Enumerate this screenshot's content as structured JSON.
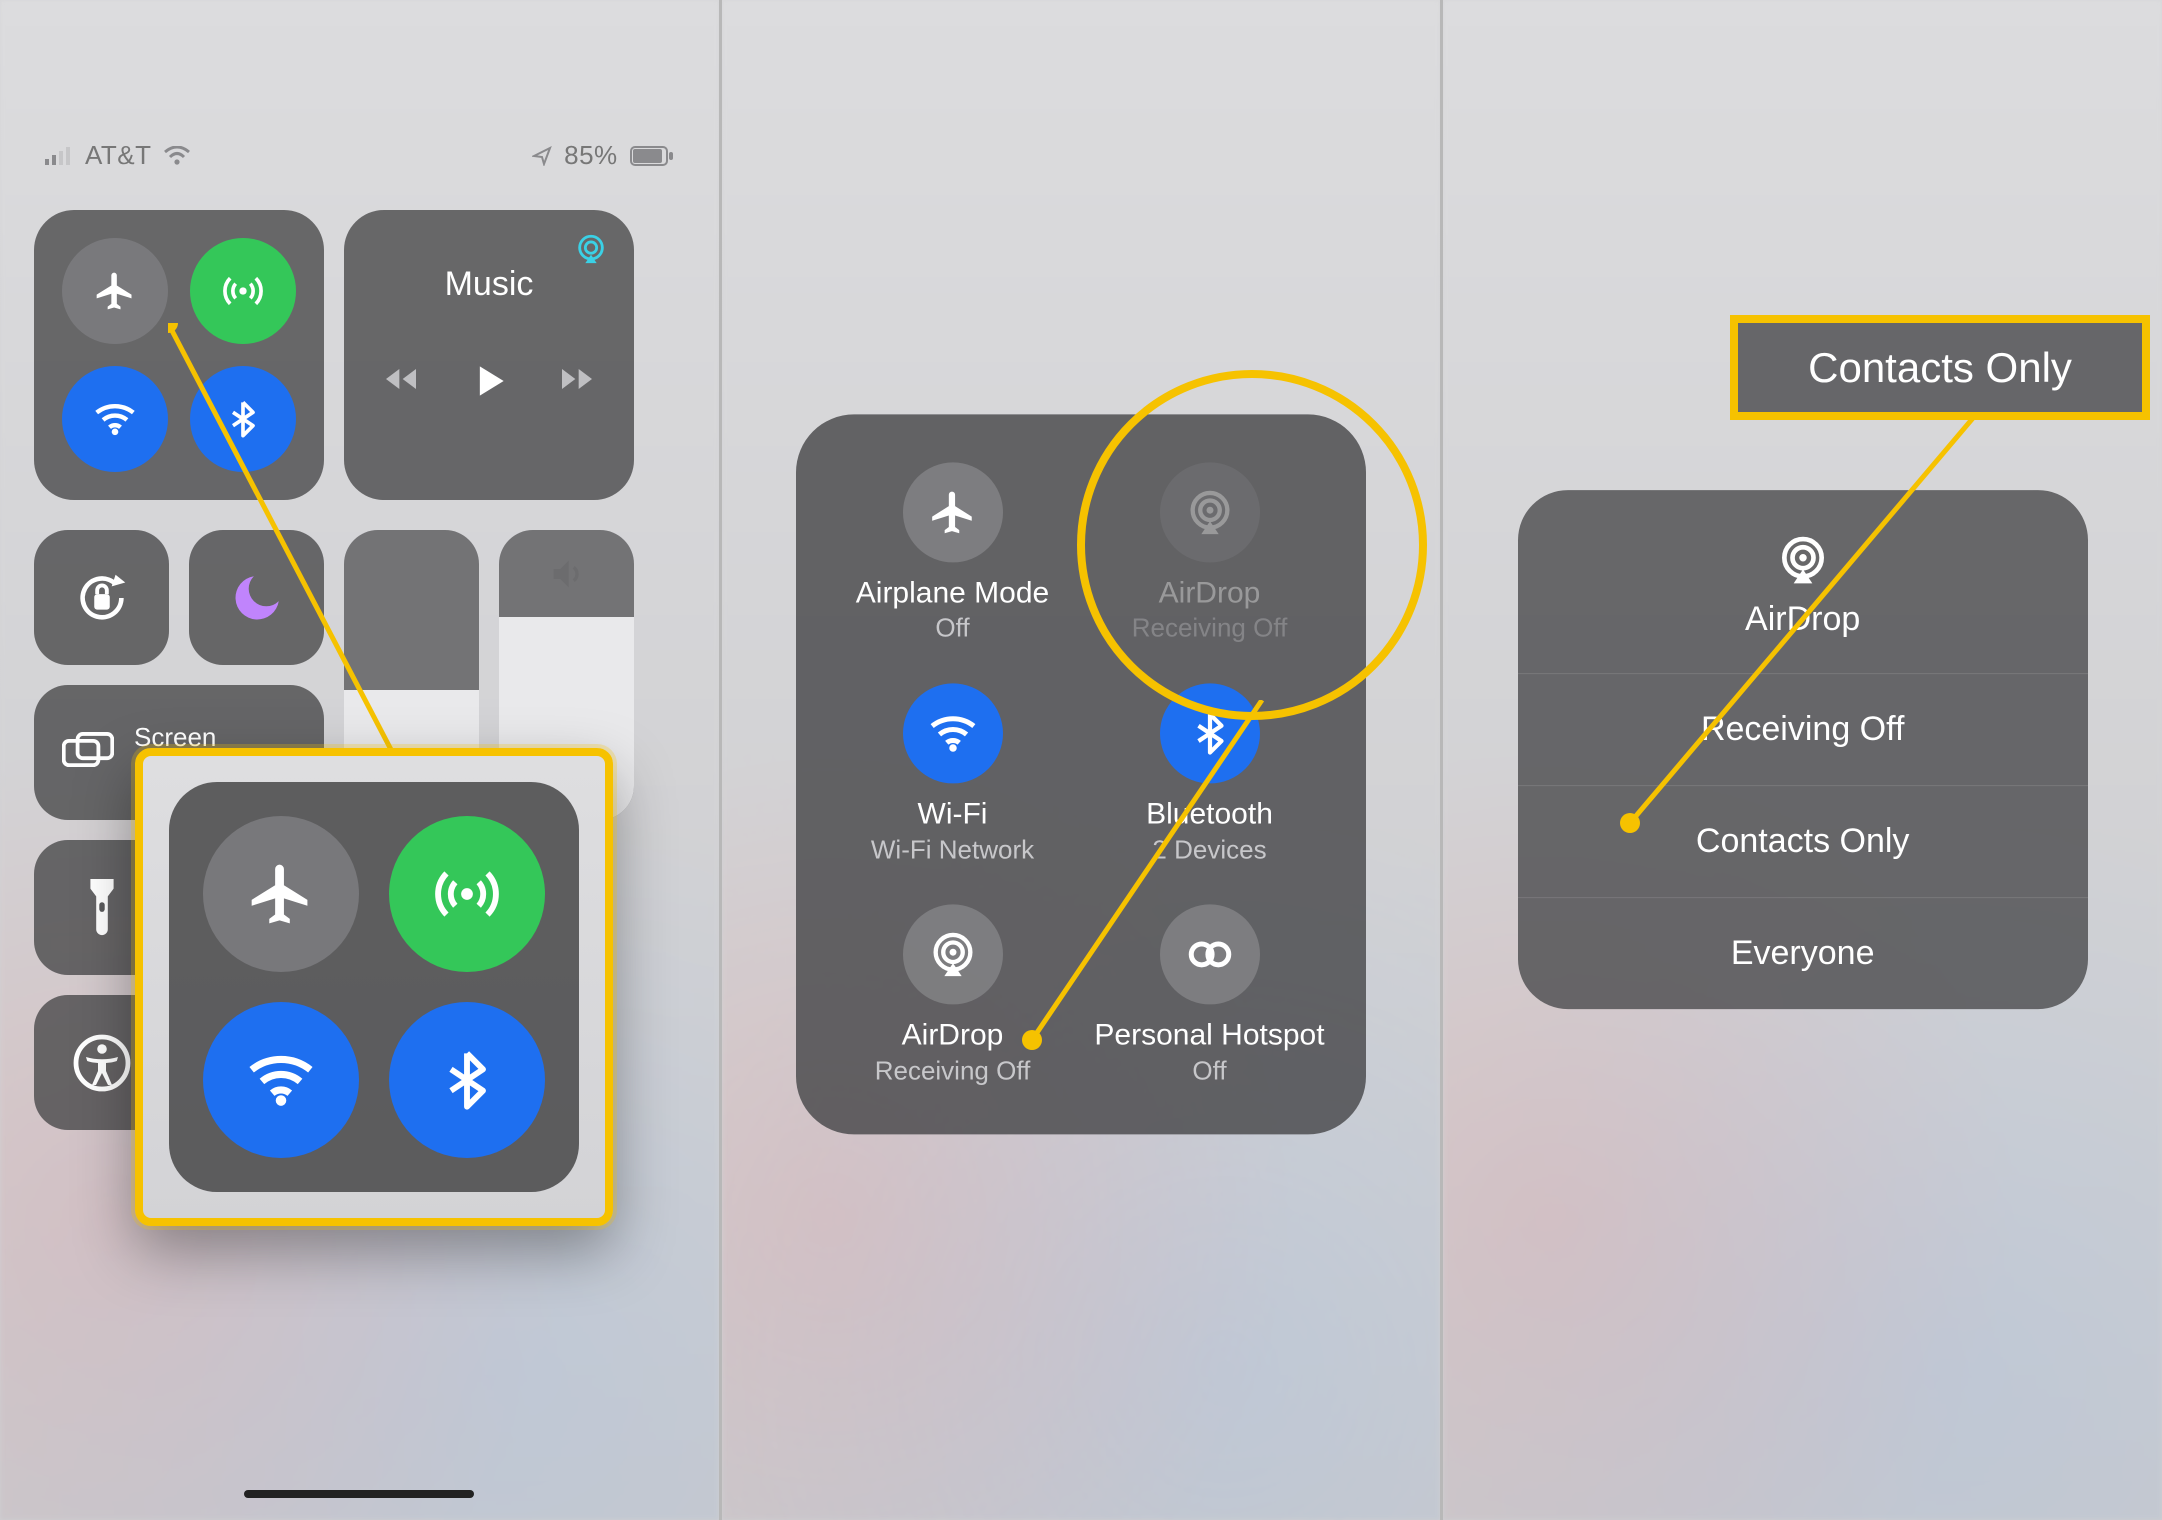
{
  "status": {
    "carrier": "AT&T",
    "battery": "85%"
  },
  "music": {
    "title": "Music"
  },
  "mirror": {
    "label": "Screen\nMirroring"
  },
  "expanded": {
    "airplane": {
      "label": "Airplane Mode",
      "sub": "Off"
    },
    "airdrop": {
      "label": "AirDrop",
      "sub": "Receiving Off"
    },
    "wifi": {
      "label": "Wi-Fi",
      "sub": "Wi-Fi Network"
    },
    "bt": {
      "label": "Bluetooth",
      "sub": "2 Devices"
    },
    "airdrop2": {
      "label": "AirDrop",
      "sub": "Receiving Off"
    },
    "hotspot": {
      "label": "Personal Hotspot",
      "sub": "Off"
    }
  },
  "menu": {
    "title": "AirDrop",
    "options": [
      "Receiving Off",
      "Contacts Only",
      "Everyone"
    ]
  },
  "callout3": "Contacts Only",
  "colors": {
    "highlight": "#f6c200",
    "blue": "#1e6ff0",
    "green": "#34c759"
  }
}
